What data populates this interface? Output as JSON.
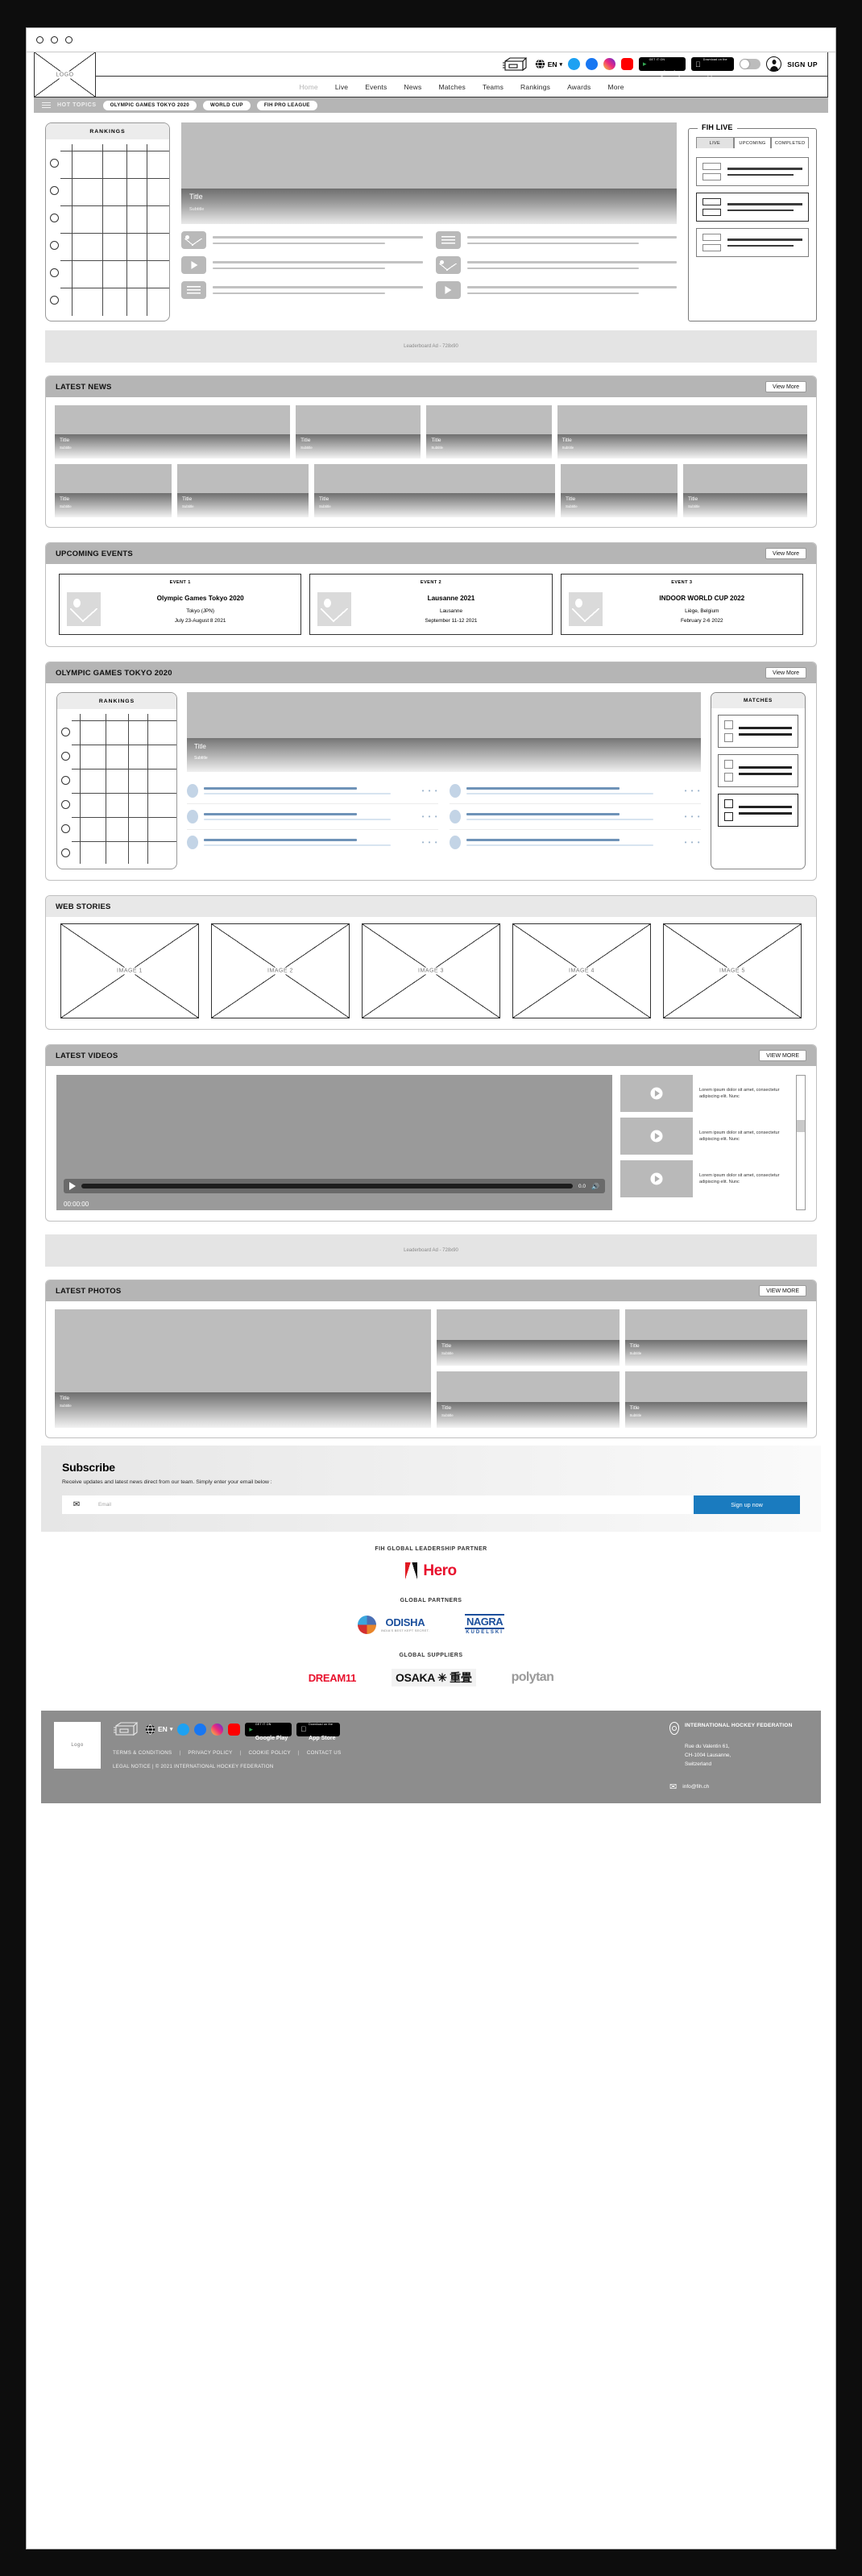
{
  "browser": {
    "dots": 3
  },
  "header": {
    "logo_label": "LOGO",
    "news_icon": "news-ticker-icon",
    "lang": "EN",
    "socials": [
      "twitter-icon",
      "facebook-icon",
      "instagram-icon",
      "youtube-icon"
    ],
    "stores": [
      {
        "small": "GET IT ON",
        "big": "Google Play"
      },
      {
        "small": "Download on the",
        "big": "App Store"
      }
    ],
    "signup_label": "SIGN UP",
    "nav": [
      "Home",
      "Live",
      "Events",
      "News",
      "Matches",
      "Teams",
      "Rankings",
      "Awards",
      "More"
    ]
  },
  "hot_topics": {
    "label": "HOT TOPICS",
    "chips": [
      "OLYMPIC GAMES TOKYO 2020",
      "WORLD CUP",
      "FIH PRO LEAGUE"
    ]
  },
  "hero": {
    "rankings_title": "RANKINGS",
    "title": "Title",
    "subtitle": "Subtitle",
    "feed_left": [
      "image-thumb",
      "play-thumb",
      "text-thumb"
    ],
    "feed_right": [
      "text-thumb",
      "image-thumb",
      "play-thumb"
    ]
  },
  "fih_live": {
    "legend": "FIH LIVE",
    "tabs": [
      "LIVE",
      "UPCOMING",
      "COMPLETED"
    ],
    "active_tab": "LIVE",
    "items": 3
  },
  "ads": {
    "top": "Leaderboard Ad - 728x90",
    "mid": "Leaderboard Ad - 728x90"
  },
  "latest_news": {
    "title": "LATEST NEWS",
    "view_more": "View More",
    "row1": [
      {
        "title": "Title",
        "subtitle": "Subtitle",
        "w": 32
      },
      {
        "title": "Title",
        "subtitle": "Subtitle",
        "w": 17
      },
      {
        "title": "Title",
        "subtitle": "Subtitle",
        "w": 17
      },
      {
        "title": "Title",
        "subtitle": "Subtitle",
        "w": 34
      }
    ],
    "row2": [
      {
        "title": "Title",
        "subtitle": "Subtitle",
        "w": 16
      },
      {
        "title": "Title",
        "subtitle": "Subtitle",
        "w": 18
      },
      {
        "title": "Title",
        "subtitle": "Subtitle",
        "w": 33
      },
      {
        "title": "Title",
        "subtitle": "Subtitle",
        "w": 16
      },
      {
        "title": "Title",
        "subtitle": "Subtitle",
        "w": 17
      }
    ]
  },
  "upcoming_events": {
    "title": "UPCOMING EVENTS",
    "view_more": "View More",
    "events": [
      {
        "tag": "EVENT 1",
        "name": "Olympic Games Tokyo  2020",
        "location": "Tokyo (JPN)",
        "date": "July 23-August 8 2021"
      },
      {
        "tag": "EVENT 2",
        "name": "Lausanne 2021",
        "location": "Lausanne",
        "date": "September 11-12 2021"
      },
      {
        "tag": "EVENT 3",
        "name": "INDOOR WORLD CUP 2022",
        "location": "Liège, Belgium",
        "date": "February 2-6 2022"
      }
    ]
  },
  "olympic": {
    "title": "OLYMPIC GAMES TOKYO 2020",
    "view_more": "View More",
    "rankings_title": "RANKINGS",
    "matches_title": "MATCHES",
    "hero_title": "Title",
    "hero_subtitle": "Subtitle",
    "dots": "• • •",
    "match_items": 3
  },
  "web_stories": {
    "title": "WEB STORIES",
    "stories": [
      "IMAGE 1",
      "IMAGE 2",
      "IMAGE 3",
      "IMAGE 4",
      "IMAGE 5"
    ]
  },
  "latest_videos": {
    "title": "LATEST VIDEOS",
    "view_more": "VIEW MORE",
    "player_time": "0.0",
    "player_stamp": "00:00:00",
    "items": [
      "Lorem ipsum dolor sit amet, consectetur adipiscing elit. Nunc",
      "Lorem ipsum dolor sit amet, consectetur adipiscing elit. Nunc",
      "Lorem ipsum dolor sit amet, consectetur adipiscing elit. Nunc"
    ]
  },
  "latest_photos": {
    "title": "LATEST PHOTOS",
    "view_more": "VIEW MORE",
    "big": {
      "title": "Title",
      "subtitle": "Subtitle"
    },
    "small": [
      {
        "title": "Title",
        "subtitle": "Subtitle"
      },
      {
        "title": "Title",
        "subtitle": "Subtitle"
      },
      {
        "title": "Title",
        "subtitle": "Subtitle"
      },
      {
        "title": "Title",
        "subtitle": "Subtitle"
      }
    ]
  },
  "subscribe": {
    "heading": "Subscribe",
    "description": "Receive updates and latest news direct from our team. Simply enter your email below :",
    "placeholder": "Email",
    "value": "",
    "button": "Sign up now",
    "button_color": "#1a7bbf"
  },
  "partners": {
    "leadership_label": "FIH GLOBAL LEADERSHIP PARTNER",
    "leadership": [
      {
        "name": "Hero",
        "color": "#e8112d"
      }
    ],
    "partners_label": "GLOBAL PARTNERS",
    "partners": [
      {
        "name": "ODISHA",
        "tagline": "INDIA'S BEST KEPT SECRET."
      },
      {
        "name": "NAGRA",
        "tagline": "KUDELSKI"
      }
    ],
    "suppliers_label": "GLOBAL SUPPLIERS",
    "suppliers": [
      {
        "name": "DREAM11"
      },
      {
        "name": "OSAKA ✳ 重畳"
      },
      {
        "name": "polytan"
      }
    ]
  },
  "footer": {
    "logo_label": "Logo",
    "lang": "EN",
    "socials": [
      "twitter-icon",
      "facebook-icon",
      "instagram-icon",
      "youtube-icon"
    ],
    "stores": [
      {
        "small": "GET IT ON",
        "big": "Google Play"
      },
      {
        "small": "Download on the",
        "big": "App Store"
      }
    ],
    "links": [
      "TERMS & CONDITIONS",
      "PRIVACY POLICY",
      "COOKIE POLICY",
      "CONTACT US"
    ],
    "separator": "|",
    "legal": "LEGAL NOTICE  |  © 2021 INTERNATIONAL HOCKEY FEDERATION",
    "org": "INTERNATIONAL HOCKEY FEDERATION",
    "address": "Rue du Valentin 61,\nCH-1004 Lausanne,\nSwitzerland",
    "email": "info@fih.ch"
  }
}
